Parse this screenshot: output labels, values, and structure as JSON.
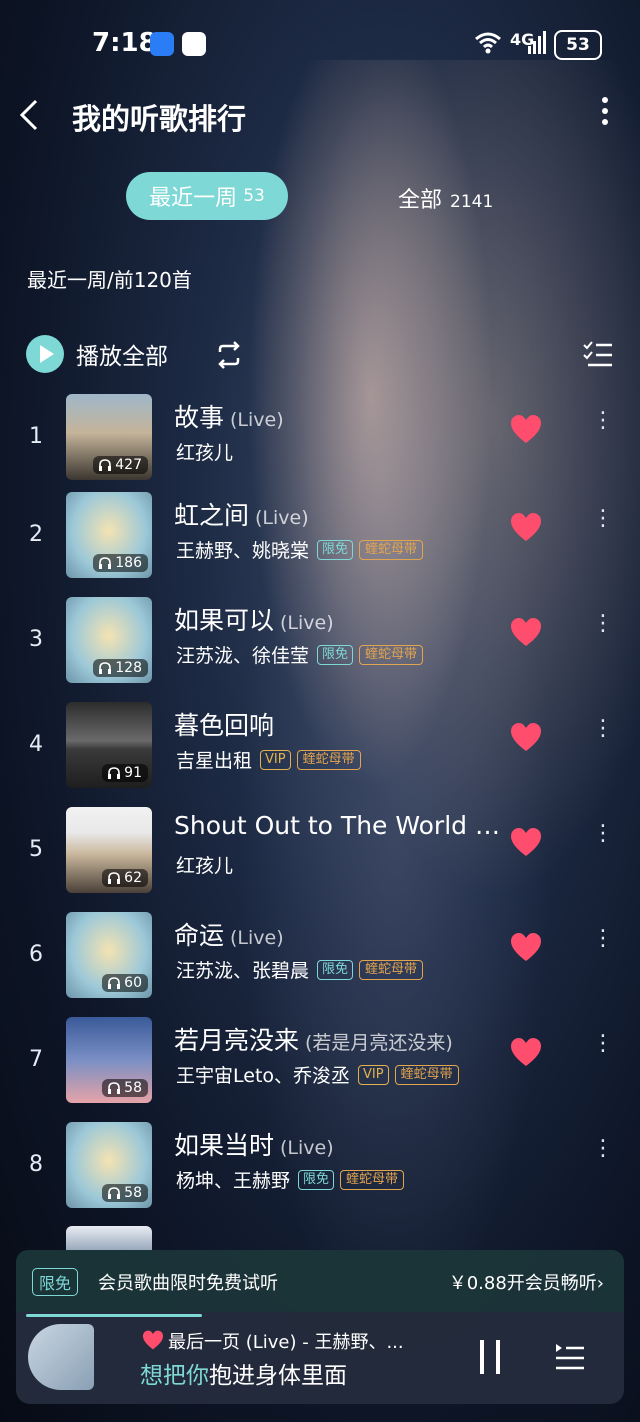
{
  "status_bar": {
    "time": "7:18",
    "network": "4G",
    "battery": "53"
  },
  "header": {
    "title": "我的听歌排行"
  },
  "tabs": [
    {
      "label": "最近一周",
      "count": "53"
    },
    {
      "label": "全部",
      "count": "2141"
    }
  ],
  "subtitle": "最近一周/前120首",
  "toolbar": {
    "play_all": "播放全部"
  },
  "colors": {
    "accent": "#7dd8d6",
    "heart": "#ff4d6d",
    "gold": "#e3a44f"
  },
  "songs": [
    {
      "rank": "1",
      "title": "故事",
      "suffix": "(Live)",
      "artist": "红孩儿",
      "plays": "427",
      "badges": []
    },
    {
      "rank": "2",
      "title": "虹之间",
      "suffix": "(Live)",
      "artist": "王赫野、姚晓棠",
      "plays": "186",
      "badges": [
        "限免",
        "蝰蛇母带"
      ]
    },
    {
      "rank": "3",
      "title": "如果可以",
      "suffix": "(Live)",
      "artist": "汪苏泷、徐佳莹",
      "plays": "128",
      "badges": [
        "限免",
        "蝰蛇母带"
      ]
    },
    {
      "rank": "4",
      "title": "暮色回响",
      "suffix": "",
      "artist": "吉星出租",
      "plays": "91",
      "badges": [
        "VIP",
        "蝰蛇母带"
      ]
    },
    {
      "rank": "5",
      "title": "Shout Out to The World ...",
      "suffix": "",
      "artist": "红孩儿",
      "plays": "62",
      "badges": []
    },
    {
      "rank": "6",
      "title": "命运",
      "suffix": "(Live)",
      "artist": "汪苏泷、张碧晨",
      "plays": "60",
      "badges": [
        "限免",
        "蝰蛇母带"
      ]
    },
    {
      "rank": "7",
      "title": "若月亮没来",
      "suffix": "(若是月亮还没来)",
      "artist": "王宇宙Leto、乔浚丞",
      "plays": "58",
      "badges": [
        "VIP",
        "蝰蛇母带"
      ]
    },
    {
      "rank": "8",
      "title": "如果当时",
      "suffix": "(Live)",
      "artist": "杨坤、王赫野",
      "plays": "58",
      "badges": [
        "限免",
        "蝰蛇母带"
      ]
    }
  ],
  "promo": {
    "badge": "限免",
    "text": "会员歌曲限时免费试听",
    "cta": "￥0.88开会员畅听›"
  },
  "player": {
    "song_line": "最后一页 (Live)  -  王赫野、...",
    "lyric_highlight": "想把你",
    "lyric_rest": "抱进身体里面",
    "progress": 0.3
  }
}
